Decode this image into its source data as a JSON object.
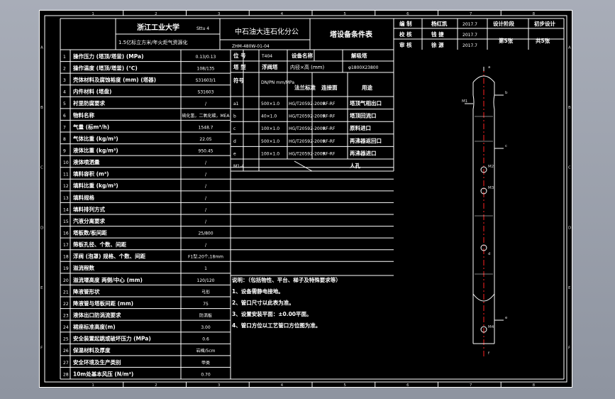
{
  "header": {
    "university": "浙江工业大学",
    "university_sub": "Sttu 4",
    "company": "中石油大连石化分公",
    "title": "塔设备条件表",
    "project": "1.5亿标立方米/年火炬气资源化",
    "drawing_no": "ZHM-480W-01-04",
    "sign_rows": [
      {
        "role": "编 制",
        "name": "杨红凯",
        "date": "2017.7"
      },
      {
        "role": "校 核",
        "name": "钱 捷",
        "date": "2017.7"
      },
      {
        "role": "审 核",
        "name": "徐 源",
        "date": "2017.7"
      }
    ],
    "stage_label": "设计阶段",
    "stage_value": "初步设计",
    "page_label": "第5张",
    "total_label": "共5张"
  },
  "params": [
    {
      "no": "1",
      "label": "操作压力 (塔顶/塔釜) (MPa)",
      "value": "0.13/0.13"
    },
    {
      "no": "2",
      "label": "操作温度 (塔顶/塔釜) (℃)",
      "value": "108/135"
    },
    {
      "no": "3",
      "label": "壳体材料及腐蚀裕度 (mm) (塔器)",
      "value": "S31603/1"
    },
    {
      "no": "4",
      "label": "内件材料 (塔盘)",
      "value": "S31603"
    },
    {
      "no": "5",
      "label": "衬里防腐要求",
      "value": "/"
    },
    {
      "no": "6",
      "label": "物料名称",
      "value": "硫化氢，二氧化碳，MEA"
    },
    {
      "no": "7",
      "label": "气量 (标m³/h)",
      "value": "1548.7"
    },
    {
      "no": "8",
      "label": "气体比重 (kg/m³)",
      "value": "22.05"
    },
    {
      "no": "9",
      "label": "液体比重 (kg/m³)",
      "value": "950.45"
    },
    {
      "no": "10",
      "label": "液体喷洒量",
      "value": "/"
    },
    {
      "no": "11",
      "label": "填料容积 (m³)",
      "value": "/"
    },
    {
      "no": "12",
      "label": "填料比重 (kg/m³)",
      "value": "/"
    },
    {
      "no": "13",
      "label": "填料规格",
      "value": "/"
    },
    {
      "no": "14",
      "label": "填料排列方式",
      "value": "/"
    },
    {
      "no": "15",
      "label": "汽液分离要求",
      "value": "/"
    },
    {
      "no": "16",
      "label": "塔板数/板间距",
      "value": "25/800"
    },
    {
      "no": "17",
      "label": "筛板孔径、个数、间距",
      "value": "/"
    },
    {
      "no": "18",
      "label": "浮阀 (泡罩) 规格、个数、间距",
      "value": "F1型,20个,18mm"
    },
    {
      "no": "19",
      "label": "溢流程数",
      "value": "1"
    },
    {
      "no": "20",
      "label": "溢流堰高度 两侧/中心 (mm)",
      "value": "120/120"
    },
    {
      "no": "21",
      "label": "降液管形状",
      "value": "弓形"
    },
    {
      "no": "22",
      "label": "降液管与塔板间距 (mm)",
      "value": "75"
    },
    {
      "no": "23",
      "label": "液体出口防涡流要求",
      "value": "防涡板"
    },
    {
      "no": "24",
      "label": "裙座标准高度(m)",
      "value": "3.00"
    },
    {
      "no": "25",
      "label": "安全装置起跳或破坏压力 (MPa)",
      "value": "0.6"
    },
    {
      "no": "26",
      "label": "保温材料及厚度",
      "value": "岩棉/5cm"
    },
    {
      "no": "27",
      "label": "安全环境及生产类别",
      "value": "甲类"
    },
    {
      "no": "28",
      "label": "10m处基本风压 (N/m²)",
      "value": "0.70"
    }
  ],
  "info": {
    "pos_label": "位 号",
    "pos_value": "T404",
    "name_label": "设备名称",
    "name_value": "解吸塔",
    "type_label": "塔 型",
    "type_value": "浮阀塔",
    "diam_label": "内径×高 (mm)",
    "diam_value": "φ1800X23800"
  },
  "nozzle_header": {
    "symbol": "符号",
    "dn": "DN/PN mm/MPa",
    "std": "法兰标准",
    "face": "连接面",
    "use": "用途"
  },
  "nozzles": [
    {
      "sym": "a1",
      "dn": "500×1.0",
      "std": "HG/T20592-2009",
      "face": "RF-RF",
      "use": "塔顶气相出口"
    },
    {
      "sym": "b",
      "dn": "40×1.0",
      "std": "HG/T20592-2009",
      "face": "RF-RF",
      "use": "塔顶回流口"
    },
    {
      "sym": "c",
      "dn": "100×1.0",
      "std": "HG/T20592-2009",
      "face": "RF-RF",
      "use": "原料进口"
    },
    {
      "sym": "d",
      "dn": "500×1.0",
      "std": "HG/T20592-2009",
      "face": "RF-RF",
      "use": "再沸器返回口"
    },
    {
      "sym": "e",
      "dn": "100×1.0",
      "std": "HG/T20592-2009",
      "face": "RF-RF",
      "use": "再沸器进口"
    },
    {
      "sym": "M1-4",
      "dn": "",
      "std": "",
      "face": "",
      "use": "人孔"
    }
  ],
  "notes": {
    "title": "说明：（包括物性、平台、梯子及特殊要求等）",
    "lines": [
      "1、设备需静电接地。",
      "2、管口尺寸以此表为准。",
      "3、设置安装平面：±0.00平面。",
      "4、管口方位以工艺管口方位图为准。"
    ]
  },
  "grid": {
    "top": [
      "1",
      "2",
      "3",
      "4",
      "5",
      "6",
      "7",
      "8"
    ],
    "side": [
      "A",
      "B",
      "C",
      "D",
      "E",
      "F"
    ]
  },
  "drawing": {
    "labels": [
      "a",
      "b",
      "M1",
      "c",
      "M2",
      "M3",
      "d",
      "M4",
      "e",
      "f"
    ]
  },
  "colors": {
    "background": "#000000",
    "lines": "#ffffff",
    "centerline": "#ff2020"
  }
}
